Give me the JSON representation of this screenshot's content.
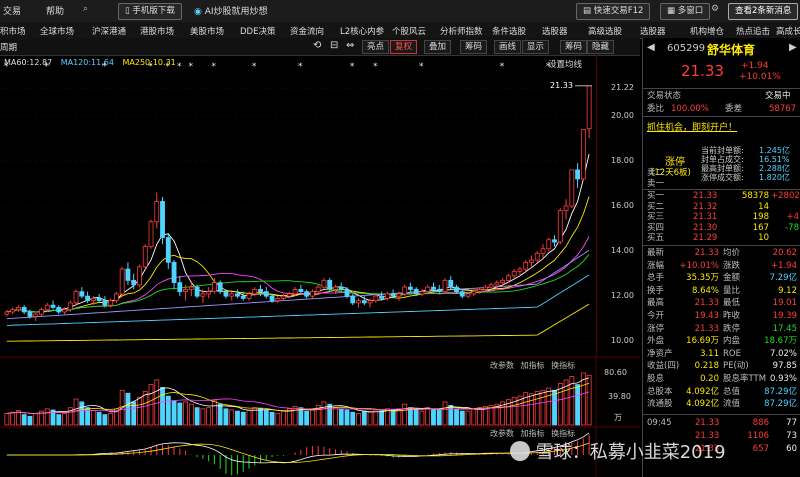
{
  "menu": {
    "items": [
      "交易",
      "帮助"
    ],
    "items_x": [
      3,
      46
    ],
    "mobile_btn": "手机版下载",
    "ai_label": "AI炒股就用炒想",
    "quick_trade": "快速交易F12",
    "multi_window": "多窗口",
    "news_btn": "查看2条新消息"
  },
  "nav": {
    "items": [
      "积市场",
      "全球市场",
      "沪深港通",
      "港股市场",
      "美股市场",
      "DDE决策",
      "资金流向",
      "L2核心内参",
      "个股风云",
      "分析师指数",
      "条件选股",
      "选股器",
      "高级选股",
      "选股器",
      "机构增仓",
      "热点追击",
      "高成长性"
    ]
  },
  "toolbar": {
    "period": "周期",
    "buttons": [
      "亮点",
      "复权",
      "叠加",
      "筹码",
      "画线",
      "显示",
      "筹码",
      "隐藏"
    ],
    "active_button": "复权"
  },
  "ma": {
    "ma60": "MA60:12.87",
    "ma120": "MA120:11.64",
    "ma250": "MA250:10.31",
    "settings": "设置均线"
  },
  "axis": {
    "price_ticks": [
      "21.22",
      "20.00",
      "18.00",
      "16.00",
      "14.00",
      "12.00",
      "10.00"
    ],
    "latest_marker": "21.33",
    "vol_ticks": [
      "80.60",
      "39.80",
      "万"
    ],
    "vol_menu": [
      "改参数",
      "加指标",
      "换指标"
    ],
    "macd_menu": [
      "改参数",
      "加指标",
      "换指标"
    ]
  },
  "stock": {
    "code": "605299",
    "name": "舒华体育",
    "price": "21.33",
    "change": "+1.94",
    "change_pct": "+10.01%",
    "status_label": "交易状态",
    "status": "交易中",
    "weibi_label": "委比",
    "weibi": "100.00%",
    "weicha_label": "委差",
    "weicha": "58767",
    "promo": "抓住机会，即刻开户！",
    "limit_title": "涨停",
    "limit_sub": "(12天6板)",
    "limit_info": [
      {
        "k": "当前封单额:",
        "v": "1.245亿"
      },
      {
        "k": "封单占成交:",
        "v": "16.51%"
      },
      {
        "k": "最高封单额:",
        "v": "2.288亿"
      },
      {
        "k": "涨停成交额:",
        "v": "1.820亿"
      }
    ],
    "sell": [
      {
        "k": "卖二",
        "p": "",
        "v": "",
        "d": ""
      },
      {
        "k": "卖一",
        "p": "",
        "v": "",
        "d": ""
      }
    ],
    "buy": [
      {
        "k": "买一",
        "p": "21.33",
        "v": "58378",
        "d": "+2802"
      },
      {
        "k": "买二",
        "p": "21.32",
        "v": "14",
        "d": ""
      },
      {
        "k": "买三",
        "p": "21.31",
        "v": "198",
        "d": "+4"
      },
      {
        "k": "买四",
        "p": "21.30",
        "v": "167",
        "d": "-78"
      },
      {
        "k": "买五",
        "p": "21.29",
        "v": "10",
        "d": ""
      }
    ],
    "stats": [
      {
        "k1": "最新",
        "v1": "21.33",
        "k2": "均价",
        "v2": "20.62"
      },
      {
        "k1": "涨幅",
        "v1": "+10.01%",
        "k2": "涨跌",
        "v2": "+1.94"
      },
      {
        "k1": "总手",
        "v1": "35.35万",
        "k2": "金额",
        "v2": "7.29亿"
      },
      {
        "k1": "换手",
        "v1": "8.64%",
        "k2": "量比",
        "v2": "9.12"
      },
      {
        "k1": "最高",
        "v1": "21.33",
        "k2": "最低",
        "v2": "19.01"
      },
      {
        "k1": "今开",
        "v1": "19.43",
        "k2": "昨收",
        "v2": "19.39"
      },
      {
        "k1": "涨停",
        "v1": "21.33",
        "k2": "跌停",
        "v2": "17.45"
      },
      {
        "k1": "外盘",
        "v1": "16.69万",
        "k2": "内盘",
        "v2": "18.67万"
      },
      {
        "k1": "净资产",
        "v1": "3.11",
        "k2": "ROE",
        "v2": "7.02%"
      },
      {
        "k1": "收益(四)",
        "v1": "0.218",
        "k2": "PE(动)",
        "v2": "97.85"
      },
      {
        "k1": "股息",
        "v1": "0.20",
        "k2": "股息率TTM",
        "v2": "0.93%"
      },
      {
        "k1": "总股本",
        "v1": "4.092亿",
        "k2": "总值",
        "v2": "87.29亿"
      },
      {
        "k1": "流通股",
        "v1": "4.092亿",
        "k2": "流值",
        "v2": "87.29亿"
      }
    ],
    "ticks": [
      {
        "t": "09:45",
        "p": "21.33",
        "v": "886",
        "n": "77"
      },
      {
        "t": "",
        "p": "21.33",
        "v": "1106",
        "n": "73"
      },
      {
        "t": "",
        "p": "21.33",
        "v": "657",
        "n": "60"
      }
    ]
  },
  "watermark": "雪球：私募小韭菜2019",
  "chart_data": {
    "type": "candlestick",
    "price_range": [
      9.3,
      21.5
    ],
    "ticks": [
      10,
      12,
      14,
      16,
      18,
      20,
      21.22
    ],
    "candles": [
      [
        11.2,
        11.4,
        11.1,
        11.3
      ],
      [
        11.3,
        11.5,
        11.2,
        11.4
      ],
      [
        11.4,
        11.6,
        11.3,
        11.5
      ],
      [
        11.5,
        11.6,
        11.2,
        11.3
      ],
      [
        11.3,
        11.4,
        11.0,
        11.1
      ],
      [
        11.1,
        11.3,
        10.9,
        11.2
      ],
      [
        11.2,
        11.5,
        11.1,
        11.4
      ],
      [
        11.4,
        11.7,
        11.3,
        11.6
      ],
      [
        11.6,
        11.8,
        11.4,
        11.5
      ],
      [
        11.5,
        11.6,
        11.2,
        11.3
      ],
      [
        11.3,
        11.5,
        11.2,
        11.4
      ],
      [
        11.4,
        11.8,
        11.3,
        11.7
      ],
      [
        11.7,
        12.3,
        11.6,
        12.2
      ],
      [
        12.2,
        12.4,
        11.9,
        12.0
      ],
      [
        12.0,
        12.2,
        11.7,
        11.8
      ],
      [
        11.8,
        12.0,
        11.6,
        11.9
      ],
      [
        11.9,
        12.1,
        11.7,
        11.8
      ],
      [
        11.8,
        12.0,
        11.5,
        11.6
      ],
      [
        11.6,
        11.9,
        11.5,
        11.8
      ],
      [
        11.8,
        12.2,
        11.7,
        12.1
      ],
      [
        12.1,
        13.3,
        12.0,
        13.2
      ],
      [
        13.2,
        13.5,
        12.5,
        12.7
      ],
      [
        12.7,
        13.0,
        12.3,
        12.5
      ],
      [
        12.5,
        13.4,
        12.4,
        13.3
      ],
      [
        13.3,
        14.3,
        13.2,
        14.2
      ],
      [
        14.2,
        15.4,
        14.1,
        15.3
      ],
      [
        15.3,
        16.6,
        15.0,
        16.2
      ],
      [
        16.2,
        16.4,
        14.3,
        14.6
      ],
      [
        14.6,
        14.8,
        13.2,
        13.5
      ],
      [
        13.5,
        13.6,
        12.3,
        12.6
      ],
      [
        12.6,
        12.9,
        12.0,
        12.2
      ],
      [
        12.2,
        12.5,
        11.8,
        12.3
      ],
      [
        12.3,
        12.6,
        12.0,
        12.4
      ],
      [
        12.4,
        12.5,
        11.9,
        12.0
      ],
      [
        12.0,
        12.3,
        11.7,
        12.1
      ],
      [
        12.1,
        12.4,
        11.9,
        12.2
      ],
      [
        12.2,
        12.8,
        12.1,
        12.6
      ],
      [
        12.6,
        12.7,
        12.1,
        12.2
      ],
      [
        12.2,
        12.3,
        11.9,
        12.0
      ],
      [
        12.0,
        12.2,
        11.8,
        12.1
      ],
      [
        12.1,
        12.3,
        11.9,
        12.0
      ],
      [
        12.0,
        12.2,
        11.8,
        11.9
      ],
      [
        11.9,
        12.2,
        11.8,
        12.1
      ],
      [
        12.1,
        12.4,
        12.0,
        12.3
      ],
      [
        12.3,
        12.5,
        12.0,
        12.2
      ],
      [
        12.2,
        12.4,
        11.9,
        12.0
      ],
      [
        12.0,
        12.1,
        11.7,
        11.8
      ],
      [
        11.8,
        12.0,
        11.7,
        11.9
      ],
      [
        11.9,
        12.1,
        11.8,
        12.0
      ],
      [
        12.0,
        12.2,
        11.9,
        12.1
      ],
      [
        12.1,
        12.4,
        12.0,
        12.3
      ],
      [
        12.3,
        12.5,
        12.1,
        12.2
      ],
      [
        12.2,
        12.3,
        11.9,
        12.0
      ],
      [
        12.0,
        12.3,
        11.9,
        12.2
      ],
      [
        12.2,
        12.5,
        12.1,
        12.4
      ],
      [
        12.4,
        12.8,
        12.3,
        12.7
      ],
      [
        12.7,
        12.8,
        12.2,
        12.3
      ],
      [
        12.3,
        12.5,
        12.1,
        12.4
      ],
      [
        12.4,
        12.6,
        12.2,
        12.3
      ],
      [
        12.3,
        12.4,
        11.9,
        12.0
      ],
      [
        12.0,
        12.1,
        11.6,
        11.7
      ],
      [
        11.7,
        11.9,
        11.5,
        11.8
      ],
      [
        11.8,
        12.0,
        11.6,
        11.7
      ],
      [
        11.7,
        11.9,
        11.5,
        11.8
      ],
      [
        11.8,
        12.1,
        11.7,
        12.0
      ],
      [
        12.0,
        12.2,
        11.8,
        11.9
      ],
      [
        11.9,
        12.2,
        11.8,
        12.1
      ],
      [
        12.1,
        12.3,
        11.9,
        12.0
      ],
      [
        12.0,
        12.2,
        11.8,
        12.1
      ],
      [
        12.1,
        12.5,
        12.0,
        12.4
      ],
      [
        12.4,
        12.6,
        12.2,
        12.3
      ],
      [
        12.3,
        12.4,
        12.0,
        12.1
      ],
      [
        12.1,
        12.3,
        12.0,
        12.2
      ],
      [
        12.2,
        12.5,
        12.1,
        12.4
      ],
      [
        12.4,
        12.6,
        12.2,
        12.3
      ],
      [
        12.3,
        12.5,
        12.1,
        12.2
      ],
      [
        12.2,
        12.8,
        12.1,
        12.7
      ],
      [
        12.7,
        12.9,
        12.3,
        12.4
      ],
      [
        12.4,
        12.5,
        12.1,
        12.2
      ],
      [
        12.2,
        12.3,
        11.9,
        12.0
      ],
      [
        12.0,
        12.2,
        11.9,
        12.1
      ],
      [
        12.1,
        12.3,
        12.0,
        12.2
      ],
      [
        12.2,
        12.4,
        12.1,
        12.3
      ],
      [
        12.3,
        12.5,
        12.2,
        12.4
      ],
      [
        12.4,
        12.6,
        12.3,
        12.5
      ],
      [
        12.5,
        12.7,
        12.3,
        12.6
      ],
      [
        12.6,
        12.8,
        12.4,
        12.7
      ],
      [
        12.7,
        13.0,
        12.6,
        12.9
      ],
      [
        12.9,
        13.2,
        12.8,
        13.1
      ],
      [
        13.1,
        13.3,
        12.9,
        13.2
      ],
      [
        13.2,
        13.6,
        13.1,
        13.5
      ],
      [
        13.5,
        13.8,
        13.3,
        13.6
      ],
      [
        13.6,
        14.0,
        13.5,
        13.9
      ],
      [
        13.9,
        14.3,
        13.7,
        14.1
      ],
      [
        14.1,
        14.6,
        14.0,
        14.5
      ],
      [
        14.5,
        14.7,
        14.2,
        14.4
      ],
      [
        14.4,
        15.9,
        14.3,
        15.8
      ],
      [
        15.8,
        16.3,
        15.4,
        16.0
      ],
      [
        16.0,
        17.6,
        15.9,
        17.6
      ],
      [
        17.6,
        17.9,
        16.8,
        17.2
      ],
      [
        17.2,
        19.4,
        17.1,
        19.39
      ],
      [
        19.43,
        21.33,
        19.01,
        21.33
      ]
    ],
    "volumes": [
      20,
      22,
      25,
      18,
      15,
      20,
      24,
      28,
      26,
      18,
      20,
      30,
      45,
      40,
      30,
      25,
      22,
      18,
      20,
      28,
      60,
      55,
      40,
      48,
      58,
      70,
      78,
      65,
      50,
      42,
      38,
      40,
      36,
      30,
      28,
      30,
      42,
      36,
      28,
      26,
      24,
      22,
      26,
      30,
      28,
      26,
      22,
      20,
      24,
      28,
      32,
      30,
      24,
      26,
      34,
      40,
      36,
      30,
      28,
      26,
      22,
      20,
      24,
      22,
      26,
      24,
      28,
      26,
      28,
      36,
      30,
      26,
      24,
      30,
      28,
      26,
      40,
      34,
      28,
      24,
      24,
      28,
      30,
      32,
      34,
      36,
      40,
      44,
      48,
      50,
      56,
      54,
      58,
      60,
      64,
      60,
      72,
      78,
      84,
      70,
      90,
      86
    ]
  }
}
